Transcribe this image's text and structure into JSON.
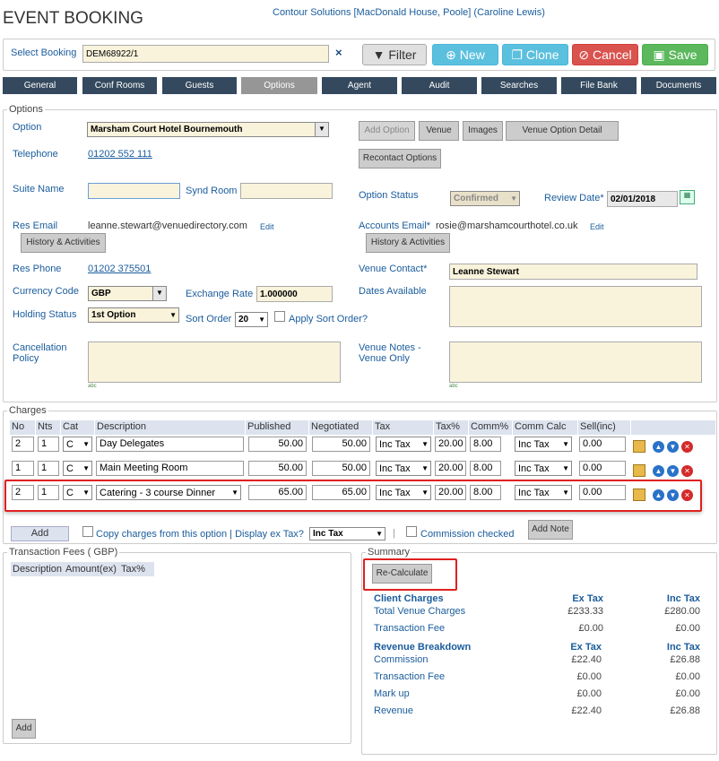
{
  "header": {
    "title": "EVENT BOOKING",
    "context": "Contour Solutions [MacDonald House, Poole] (Caroline Lewis)"
  },
  "toolbar": {
    "select_label": "Select Booking",
    "booking_value": "DEM68922/1",
    "filter": "Filter",
    "new": "New",
    "clone": "Clone",
    "cancel": "Cancel",
    "save": "Save"
  },
  "tabs": [
    "General",
    "Conf Rooms",
    "Guests",
    "Options",
    "Agent",
    "Audit",
    "Searches",
    "File Bank",
    "Documents"
  ],
  "options": {
    "legend": "Options",
    "option_label": "Option",
    "option_value": "Marsham Court Hotel Bournemouth",
    "add_option": "Add Option",
    "venue": "Venue",
    "images": "Images",
    "venue_option_detail": "Venue Option Detail",
    "recontact": "Recontact Options",
    "telephone_label": "Telephone",
    "telephone": "01202 552 111",
    "suite_label": "Suite Name",
    "synd_label": "Synd Room",
    "status_label": "Option Status",
    "status_value": "Confirmed",
    "review_label": "Review Date*",
    "review_value": "02/01/2018",
    "res_email_label": "Res Email",
    "res_email": "leanne.stewart@venuedirectory.com",
    "edit": "Edit",
    "accounts_label": "Accounts Email*",
    "accounts_email": "rosie@marshamcourthotel.co.uk",
    "history": "History & Activities",
    "res_phone_label": "Res Phone",
    "res_phone": "01202 375501",
    "contact_label": "Venue Contact*",
    "contact_value": "Leanne Stewart",
    "currency_label": "Currency Code",
    "currency_value": "GBP",
    "exchange_label": "Exchange Rate",
    "exchange_value": "1.000000",
    "dates_label": "Dates Available",
    "holding_label": "Holding Status",
    "holding_value": "1st Option",
    "sort_label": "Sort Order",
    "sort_value": "20",
    "apply_sort": "Apply Sort Order?",
    "cancellation_label": "Cancellation Policy",
    "notes_label": "Venue Notes - Venue Only",
    "spell": "abc"
  },
  "charges": {
    "legend": "Charges",
    "headers": [
      "No",
      "Nts",
      "Cat",
      "Description",
      "Published",
      "Negotiated",
      "Tax",
      "Tax%",
      "Comm%",
      "Comm Calc",
      "Sell(inc)"
    ],
    "rows": [
      {
        "no": "2",
        "nts": "1",
        "cat": "C",
        "desc": "Day Delegates",
        "published": "50.00",
        "negotiated": "50.00",
        "tax": "Inc Tax",
        "taxp": "20.00",
        "comm": "8.00",
        "calc": "Inc Tax",
        "sell": "0.00"
      },
      {
        "no": "1",
        "nts": "1",
        "cat": "C",
        "desc": "Main Meeting Room",
        "published": "50.00",
        "negotiated": "50.00",
        "tax": "Inc Tax",
        "taxp": "20.00",
        "comm": "8.00",
        "calc": "Inc Tax",
        "sell": "0.00"
      },
      {
        "no": "2",
        "nts": "1",
        "cat": "C",
        "desc": "Catering - 3 course Dinner",
        "published": "65.00",
        "negotiated": "65.00",
        "tax": "Inc Tax",
        "taxp": "20.00",
        "comm": "8.00",
        "calc": "Inc Tax",
        "sell": "0.00"
      }
    ],
    "add": "Add",
    "copy": "Copy charges from this option | Display ex Tax?",
    "display_value": "Inc Tax",
    "sep": "|",
    "commission_checked": "Commission checked",
    "add_note": "Add Note"
  },
  "transaction": {
    "legend": "Transaction Fees ( GBP)",
    "headers": [
      "Description",
      "Amount(ex)",
      "Tax%"
    ],
    "add": "Add"
  },
  "summary": {
    "legend": "Summary",
    "recalc": "Re-Calculate",
    "client_charges": "Client Charges",
    "ex_tax": "Ex Tax",
    "inc_tax": "Inc Tax",
    "total_venue": "Total Venue Charges",
    "total_venue_ex": "£233.33",
    "total_venue_inc": "£280.00",
    "fee": "Transaction Fee",
    "fee_ex": "£0.00",
    "fee_inc": "£0.00",
    "revenue_breakdown": "Revenue Breakdown",
    "commission": "Commission",
    "commission_ex": "£22.40",
    "commission_inc": "£26.88",
    "fee2": "Transaction Fee",
    "fee2_ex": "£0.00",
    "fee2_inc": "£0.00",
    "markup": "Mark up",
    "markup_ex": "£0.00",
    "markup_inc": "£0.00",
    "revenue": "Revenue",
    "revenue_ex": "£22.40",
    "revenue_inc": "£26.88"
  },
  "colors": {
    "nav": "#34495e",
    "accent": "#1a5c9c",
    "new": "#5bc0de",
    "clone": "#5bc0de",
    "cancel": "#d9534f",
    "save": "#5cb85c",
    "highlight": "#e02020"
  }
}
